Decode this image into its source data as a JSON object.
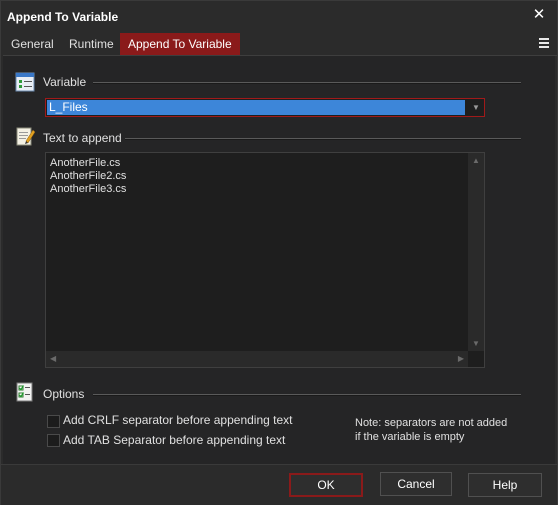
{
  "window": {
    "title": "Append To Variable"
  },
  "tabs": [
    {
      "label": "General"
    },
    {
      "label": "Runtime"
    },
    {
      "label": "Append To Variable"
    }
  ],
  "variable_section": {
    "label": "Variable",
    "selected_value": "L_Files"
  },
  "text_section": {
    "label": "Text to append",
    "lines": [
      "AnotherFile.cs",
      "AnotherFile2.cs",
      "AnotherFile3.cs"
    ]
  },
  "options_section": {
    "label": "Options",
    "crlf_label": "Add CRLF separator before appending text",
    "crlf_checked": false,
    "tab_label": "Add TAB Separator before appending text",
    "tab_checked": false,
    "note_line1": "Note: separators are not added",
    "note_line2": "if the variable is empty"
  },
  "footer": {
    "ok_label": "OK",
    "cancel_label": "Cancel",
    "help_label": "Help"
  },
  "colors": {
    "accent": "#8a1a1a",
    "selection": "#3d86d9"
  },
  "icons": {
    "variable": "variable-list-icon",
    "text": "pencil-note-icon",
    "options": "checklist-icon",
    "close": "close-icon",
    "menu": "hamburger-menu-icon"
  }
}
